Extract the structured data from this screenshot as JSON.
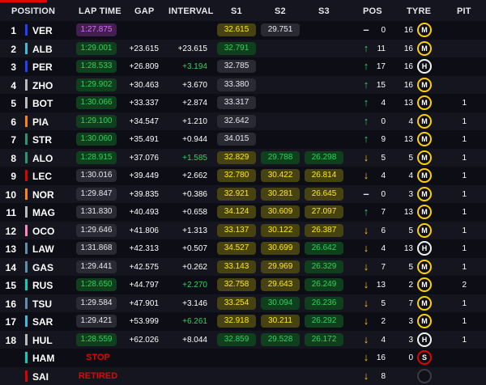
{
  "header": {
    "position": "POSITION",
    "lap_time": "LAP TIME",
    "gap": "GAP",
    "interval": "INTERVAL",
    "s1": "S1",
    "s2": "S2",
    "s3": "S3",
    "pos": "POS",
    "tyre": "TYRE",
    "pit": "PIT"
  },
  "colors": {
    "accent": "#e10600",
    "personal_best": "#2ed35a",
    "overall_best": "#d86cff",
    "sector_yellow": "#ffe81a",
    "soft": "#e10600",
    "medium": "#ffd000",
    "hard": "#f2f2f2"
  },
  "rows": [
    {
      "pos": "1",
      "team": "#1e41ff",
      "driver": "VER",
      "lap": "1:27.875",
      "lap_c": "best",
      "gap": "",
      "int": "",
      "int_c": "",
      "s1": "32.615",
      "s1_c": "yel",
      "s2": "29.751",
      "s2_c": "wht",
      "s3": "",
      "s3_c": "",
      "arrow": "same",
      "chg": "0",
      "tlaps": "16",
      "tyre": "M",
      "pit": ""
    },
    {
      "pos": "2",
      "team": "#37bedd",
      "driver": "ALB",
      "lap": "1:29.001",
      "lap_c": "pb",
      "gap": "+23.615",
      "int": "+23.615",
      "int_c": "",
      "s1": "32.791",
      "s1_c": "pb",
      "s2": "",
      "s2_c": "",
      "s3": "",
      "s3_c": "",
      "arrow": "up",
      "chg": "11",
      "tlaps": "16",
      "tyre": "M",
      "pit": ""
    },
    {
      "pos": "3",
      "team": "#1e41ff",
      "driver": "PER",
      "lap": "1:28.533",
      "lap_c": "pb",
      "gap": "+26.809",
      "int": "+3.194",
      "int_c": "green",
      "s1": "32.785",
      "s1_c": "wht",
      "s2": "",
      "s2_c": "",
      "s3": "",
      "s3_c": "",
      "arrow": "up",
      "chg": "17",
      "tlaps": "16",
      "tyre": "H",
      "pit": ""
    },
    {
      "pos": "4",
      "team": "#b6babd",
      "driver": "ZHO",
      "lap": "1:29.902",
      "lap_c": "pb",
      "gap": "+30.463",
      "int": "+3.670",
      "int_c": "",
      "s1": "33.380",
      "s1_c": "wht",
      "s2": "",
      "s2_c": "",
      "s3": "",
      "s3_c": "",
      "arrow": "up",
      "chg": "15",
      "tlaps": "16",
      "tyre": "M",
      "pit": ""
    },
    {
      "pos": "5",
      "team": "#b6babd",
      "driver": "BOT",
      "lap": "1:30.066",
      "lap_c": "pb",
      "gap": "+33.337",
      "int": "+2.874",
      "int_c": "",
      "s1": "33.317",
      "s1_c": "wht",
      "s2": "",
      "s2_c": "",
      "s3": "",
      "s3_c": "",
      "arrow": "up",
      "chg": "4",
      "tlaps": "13",
      "tyre": "M",
      "pit": "1"
    },
    {
      "pos": "6",
      "team": "#ff8700",
      "driver": "PIA",
      "lap": "1:29.100",
      "lap_c": "pb",
      "gap": "+34.547",
      "int": "+1.210",
      "int_c": "",
      "s1": "32.642",
      "s1_c": "wht",
      "s2": "",
      "s2_c": "",
      "s3": "",
      "s3_c": "",
      "arrow": "up",
      "chg": "0",
      "tlaps": "4",
      "tyre": "M",
      "pit": "1"
    },
    {
      "pos": "7",
      "team": "#229971",
      "driver": "STR",
      "lap": "1:30.060",
      "lap_c": "pb",
      "gap": "+35.491",
      "int": "+0.944",
      "int_c": "",
      "s1": "34.015",
      "s1_c": "wht",
      "s2": "",
      "s2_c": "",
      "s3": "",
      "s3_c": "",
      "arrow": "up",
      "chg": "9",
      "tlaps": "13",
      "tyre": "M",
      "pit": "1"
    },
    {
      "pos": "8",
      "team": "#229971",
      "driver": "ALO",
      "lap": "1:28.915",
      "lap_c": "pb",
      "gap": "+37.076",
      "int": "+1.585",
      "int_c": "green",
      "s1": "32.829",
      "s1_c": "yel",
      "s2": "29.788",
      "s2_c": "pb",
      "s3": "26.298",
      "s3_c": "pb",
      "arrow": "down",
      "chg": "5",
      "tlaps": "5",
      "tyre": "M",
      "pit": "1"
    },
    {
      "pos": "9",
      "team": "#dc0000",
      "driver": "LEC",
      "lap": "1:30.016",
      "lap_c": "wht",
      "gap": "+39.449",
      "int": "+2.662",
      "int_c": "",
      "s1": "32.780",
      "s1_c": "yel",
      "s2": "30.422",
      "s2_c": "yel",
      "s3": "26.814",
      "s3_c": "yel",
      "arrow": "down",
      "chg": "4",
      "tlaps": "4",
      "tyre": "M",
      "pit": "1"
    },
    {
      "pos": "10",
      "team": "#ff8700",
      "driver": "NOR",
      "lap": "1:29.847",
      "lap_c": "wht",
      "gap": "+39.835",
      "int": "+0.386",
      "int_c": "",
      "s1": "32.921",
      "s1_c": "yel",
      "s2": "30.281",
      "s2_c": "yel",
      "s3": "26.645",
      "s3_c": "yel",
      "arrow": "same",
      "chg": "0",
      "tlaps": "3",
      "tyre": "M",
      "pit": "1"
    },
    {
      "pos": "11",
      "team": "#b6babd",
      "driver": "MAG",
      "lap": "1:31.830",
      "lap_c": "wht",
      "gap": "+40.493",
      "int": "+0.658",
      "int_c": "",
      "s1": "34.124",
      "s1_c": "yel",
      "s2": "30.609",
      "s2_c": "yel",
      "s3": "27.097",
      "s3_c": "yel",
      "arrow": "up",
      "chg": "7",
      "tlaps": "13",
      "tyre": "M",
      "pit": "1"
    },
    {
      "pos": "12",
      "team": "#ff87bc",
      "driver": "OCO",
      "lap": "1:29.646",
      "lap_c": "wht",
      "gap": "+41.806",
      "int": "+1.313",
      "int_c": "",
      "s1": "33.137",
      "s1_c": "yel",
      "s2": "30.122",
      "s2_c": "yel",
      "s3": "26.387",
      "s3_c": "yel",
      "arrow": "down",
      "chg": "6",
      "tlaps": "5",
      "tyre": "M",
      "pit": "1"
    },
    {
      "pos": "13",
      "team": "#5e8faa",
      "driver": "LAW",
      "lap": "1:31.868",
      "lap_c": "wht",
      "gap": "+42.313",
      "int": "+0.507",
      "int_c": "",
      "s1": "34.527",
      "s1_c": "yel",
      "s2": "30.699",
      "s2_c": "yel",
      "s3": "26.642",
      "s3_c": "pb",
      "arrow": "down",
      "chg": "4",
      "tlaps": "13",
      "tyre": "H",
      "pit": "1"
    },
    {
      "pos": "14",
      "team": "#5e8faa",
      "driver": "GAS",
      "lap": "1:29.441",
      "lap_c": "wht",
      "gap": "+42.575",
      "int": "+0.262",
      "int_c": "",
      "s1": "33.143",
      "s1_c": "yel",
      "s2": "29.969",
      "s2_c": "yel",
      "s3": "26.329",
      "s3_c": "pb",
      "arrow": "down",
      "chg": "7",
      "tlaps": "5",
      "tyre": "M",
      "pit": "1"
    },
    {
      "pos": "15",
      "team": "#00d2be",
      "driver": "RUS",
      "lap": "1:28.650",
      "lap_c": "pb",
      "gap": "+44.797",
      "int": "+2.270",
      "int_c": "green",
      "s1": "32.758",
      "s1_c": "yel",
      "s2": "29.643",
      "s2_c": "yel",
      "s3": "26.249",
      "s3_c": "pb",
      "arrow": "down",
      "chg": "13",
      "tlaps": "2",
      "tyre": "M",
      "pit": "2"
    },
    {
      "pos": "16",
      "team": "#5e8faa",
      "driver": "TSU",
      "lap": "1:29.584",
      "lap_c": "wht",
      "gap": "+47.901",
      "int": "+3.146",
      "int_c": "",
      "s1": "33.254",
      "s1_c": "yel",
      "s2": "30.094",
      "s2_c": "pb",
      "s3": "26.236",
      "s3_c": "pb",
      "arrow": "down",
      "chg": "5",
      "tlaps": "7",
      "tyre": "M",
      "pit": "1"
    },
    {
      "pos": "17",
      "team": "#37bedd",
      "driver": "SAR",
      "lap": "1:29.421",
      "lap_c": "wht",
      "gap": "+53.999",
      "int": "+6.261",
      "int_c": "green",
      "s1": "32.918",
      "s1_c": "yel",
      "s2": "30.211",
      "s2_c": "yel",
      "s3": "26.292",
      "s3_c": "pb",
      "arrow": "down",
      "chg": "2",
      "tlaps": "3",
      "tyre": "M",
      "pit": "1"
    },
    {
      "pos": "18",
      "team": "#b6babd",
      "driver": "HUL",
      "lap": "1:28.559",
      "lap_c": "pb",
      "gap": "+62.026",
      "int": "+8.044",
      "int_c": "",
      "s1": "32.859",
      "s1_c": "pb",
      "s2": "29.528",
      "s2_c": "pb",
      "s3": "26.172",
      "s3_c": "pb",
      "arrow": "down",
      "chg": "4",
      "tlaps": "3",
      "tyre": "H",
      "pit": "1"
    },
    {
      "pos": "",
      "team": "#00d2be",
      "driver": "HAM",
      "status": "STOP",
      "arrow": "down",
      "chg": "16",
      "tlaps": "0",
      "tyre": "S",
      "pit": ""
    },
    {
      "pos": "",
      "team": "#dc0000",
      "driver": "SAI",
      "status": "RETIRED",
      "arrow": "down",
      "chg": "8",
      "tlaps": "",
      "tyre": "X",
      "pit": ""
    }
  ]
}
